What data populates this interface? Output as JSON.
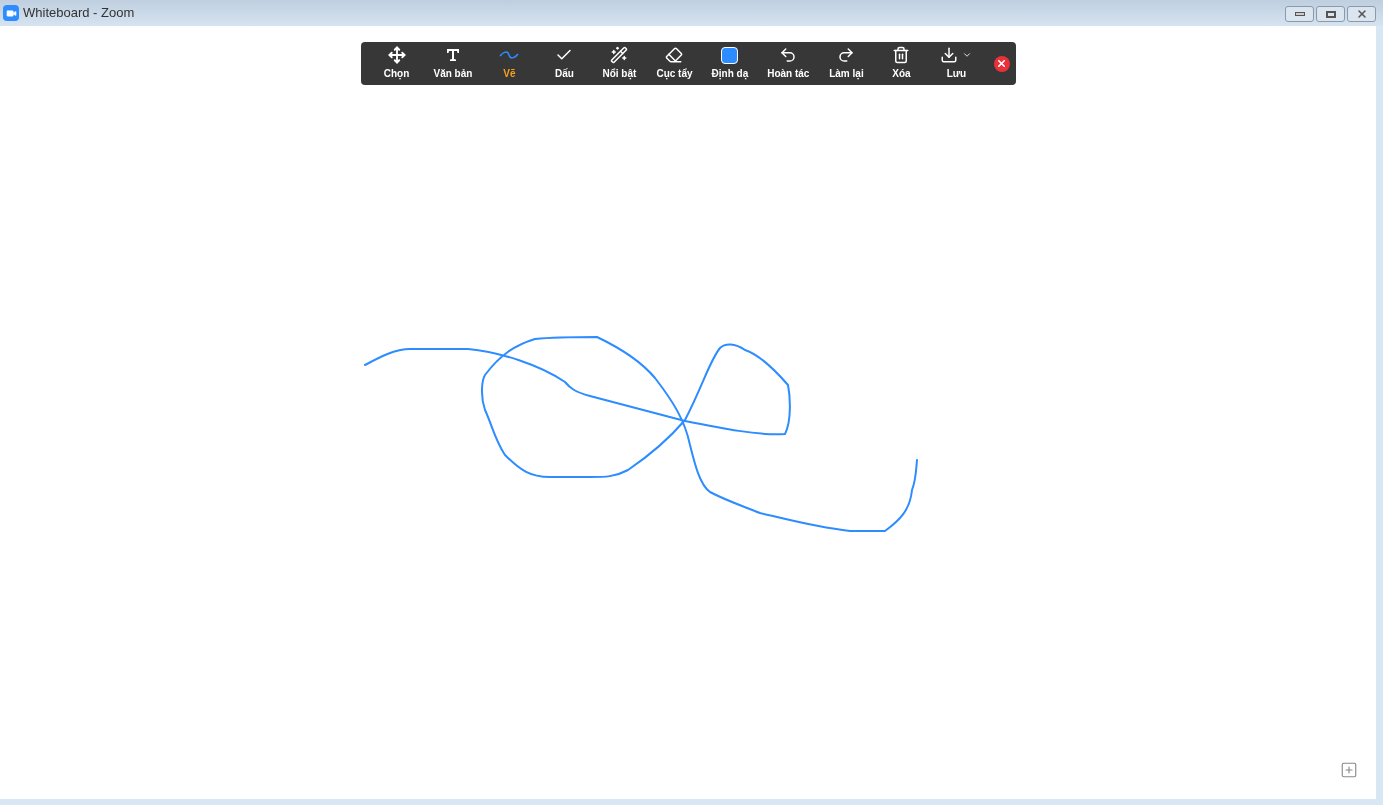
{
  "window": {
    "title": "Whiteboard - Zoom"
  },
  "toolbar": [
    {
      "kind": "select",
      "label": "Chọn",
      "selected": false
    },
    {
      "kind": "text",
      "label": "Văn bản",
      "selected": false
    },
    {
      "kind": "draw",
      "label": "Vẽ",
      "selected": true
    },
    {
      "kind": "stamp",
      "label": "Dấu",
      "selected": false
    },
    {
      "kind": "spotlight",
      "label": "Nổi bật",
      "selected": false
    },
    {
      "kind": "eraser",
      "label": "Cục tẩy",
      "selected": false
    },
    {
      "kind": "format",
      "label": "Định dạ",
      "selected": false
    },
    {
      "kind": "undo",
      "label": "Hoàn tác",
      "selected": false
    },
    {
      "kind": "redo",
      "label": "Làm lại",
      "selected": false
    },
    {
      "kind": "clear",
      "label": "Xóa",
      "selected": false
    },
    {
      "kind": "save",
      "label": "Lưu",
      "selected": false
    }
  ]
}
